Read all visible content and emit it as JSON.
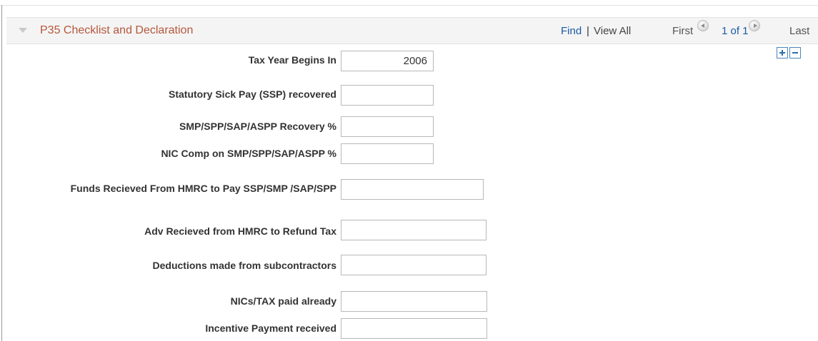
{
  "section": {
    "title": "P35 Checklist and Declaration"
  },
  "nav": {
    "find": "Find",
    "separator": "|",
    "view_all": "View All",
    "first": "First",
    "count": "1 of 1",
    "last": "Last"
  },
  "fields": {
    "tax_year": {
      "label": "Tax Year Begins In",
      "value": "2006"
    },
    "ssp_recovered": {
      "label": "Statutory Sick Pay (SSP) recovered",
      "value": ""
    },
    "recovery_pct": {
      "label": "SMP/SPP/SAP/ASPP Recovery %",
      "value": ""
    },
    "nic_comp_pct": {
      "label": "NIC Comp on SMP/SPP/SAP/ASPP %",
      "value": ""
    },
    "funds_received": {
      "label": "Funds Recieved From HMRC to Pay SSP/SMP /SAP/SPP",
      "value": ""
    },
    "adv_received": {
      "label": "Adv Recieved from HMRC to Refund Tax",
      "value": ""
    },
    "deductions": {
      "label": "Deductions made from subcontractors",
      "value": ""
    },
    "nics_tax_paid": {
      "label": "NICs/TAX paid already",
      "value": ""
    },
    "incentive_payment": {
      "label": "Incentive Payment received",
      "value": ""
    }
  },
  "colors": {
    "title": "#b5573a",
    "link": "#1a5aa6",
    "header_bg": "#f4f4f4",
    "label": "#333333"
  },
  "icons": {
    "collapse": "collapse-triangle-icon",
    "previous": "previous-circle-icon",
    "next": "next-circle-icon",
    "add_row": "plus-icon",
    "delete_row": "minus-icon"
  }
}
